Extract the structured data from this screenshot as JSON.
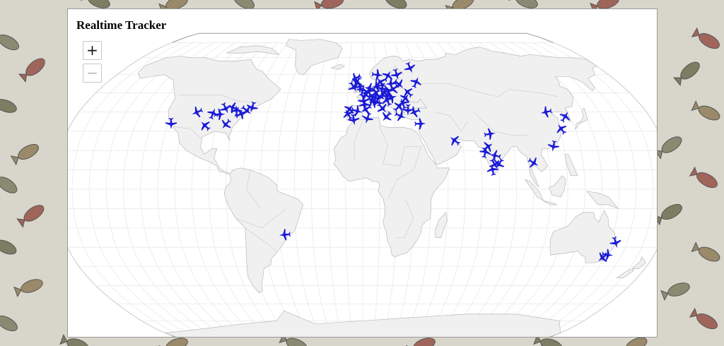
{
  "title": "Realtime Tracker",
  "zoom": {
    "in_label": "+",
    "out_label": "−"
  },
  "colors": {
    "plane": "#1a1ad6",
    "land": "#f0f0f0",
    "ocean": "#ffffff",
    "background": "#d8d5ca"
  },
  "map": {
    "projection": "robinson",
    "graticule_step_deg": 10
  },
  "aircraft": [
    {
      "lon": -118.4,
      "lat": 34.0
    },
    {
      "lon": -104.9,
      "lat": 39.8
    },
    {
      "lon": -97.0,
      "lat": 32.9
    },
    {
      "lon": -94.6,
      "lat": 39.1
    },
    {
      "lon": -90.3,
      "lat": 38.7
    },
    {
      "lon": -87.9,
      "lat": 41.9
    },
    {
      "lon": -84.4,
      "lat": 33.6
    },
    {
      "lon": -83.3,
      "lat": 42.2
    },
    {
      "lon": -80.3,
      "lat": 40.5
    },
    {
      "lon": -77.0,
      "lat": 38.9
    },
    {
      "lon": -74.0,
      "lat": 40.7
    },
    {
      "lon": -71.0,
      "lat": 42.4
    },
    {
      "lon": -46.6,
      "lat": -23.5
    },
    {
      "lon": -9.1,
      "lat": 38.7
    },
    {
      "lon": -8.6,
      "lat": 41.2
    },
    {
      "lon": -3.7,
      "lat": 40.4
    },
    {
      "lon": -5.6,
      "lat": 36.0
    },
    {
      "lon": 2.1,
      "lat": 41.4
    },
    {
      "lon": 2.3,
      "lat": 48.9
    },
    {
      "lon": -0.1,
      "lat": 51.5
    },
    {
      "lon": -2.2,
      "lat": 53.4
    },
    {
      "lon": -6.3,
      "lat": 53.3
    },
    {
      "lon": -4.2,
      "lat": 55.9
    },
    {
      "lon": 4.9,
      "lat": 52.4
    },
    {
      "lon": 4.4,
      "lat": 50.8
    },
    {
      "lon": 8.7,
      "lat": 50.1
    },
    {
      "lon": 11.6,
      "lat": 48.1
    },
    {
      "lon": 13.4,
      "lat": 52.5
    },
    {
      "lon": 10.0,
      "lat": 53.6
    },
    {
      "lon": 12.6,
      "lat": 55.7
    },
    {
      "lon": 18.1,
      "lat": 59.3
    },
    {
      "lon": 10.7,
      "lat": 59.9
    },
    {
      "lon": 24.9,
      "lat": 60.2
    },
    {
      "lon": 21.0,
      "lat": 52.2
    },
    {
      "lon": 14.4,
      "lat": 50.1
    },
    {
      "lon": 16.4,
      "lat": 48.2
    },
    {
      "lon": 19.0,
      "lat": 47.5
    },
    {
      "lon": 12.5,
      "lat": 41.9
    },
    {
      "lon": 9.2,
      "lat": 45.5
    },
    {
      "lon": 7.7,
      "lat": 45.1
    },
    {
      "lon": 26.1,
      "lat": 44.4
    },
    {
      "lon": 23.3,
      "lat": 42.7
    },
    {
      "lon": 23.7,
      "lat": 37.9
    },
    {
      "lon": 28.9,
      "lat": 41.0
    },
    {
      "lon": 32.9,
      "lat": 39.9
    },
    {
      "lon": 30.5,
      "lat": 50.4
    },
    {
      "lon": 37.6,
      "lat": 55.8
    },
    {
      "lon": 35.5,
      "lat": 33.9
    },
    {
      "lon": 36.0,
      "lat": 64.0
    },
    {
      "lon": 15.0,
      "lat": 37.5
    },
    {
      "lon": 6.1,
      "lat": 46.2
    },
    {
      "lon": 1.4,
      "lat": 43.6
    },
    {
      "lon": 17.0,
      "lat": 51.1
    },
    {
      "lon": 25.3,
      "lat": 54.7
    },
    {
      "lon": 3.0,
      "lat": 36.7
    },
    {
      "lon": 20.0,
      "lat": 55.0
    },
    {
      "lon": 16.0,
      "lat": 46.0
    },
    {
      "lon": 28.0,
      "lat": 47.0
    },
    {
      "lon": 8.0,
      "lat": 47.5
    },
    {
      "lon": 0.5,
      "lat": 46.0
    },
    {
      "lon": -5.0,
      "lat": 58.0
    },
    {
      "lon": 55.3,
      "lat": 25.2
    },
    {
      "lon": 72.9,
      "lat": 19.1
    },
    {
      "lon": 77.1,
      "lat": 28.6
    },
    {
      "lon": 77.7,
      "lat": 13.0
    },
    {
      "lon": 80.3,
      "lat": 13.1
    },
    {
      "lon": 78.5,
      "lat": 17.4
    },
    {
      "lon": 76.3,
      "lat": 10.0
    },
    {
      "lon": 74.8,
      "lat": 22.0
    },
    {
      "lon": 100.7,
      "lat": 13.7
    },
    {
      "lon": 114.1,
      "lat": 22.3
    },
    {
      "lon": 116.4,
      "lat": 39.9
    },
    {
      "lon": 121.5,
      "lat": 31.2
    },
    {
      "lon": 126.9,
      "lat": 37.5
    },
    {
      "lon": 151.2,
      "lat": -33.9
    },
    {
      "lon": 153.0,
      "lat": -27.5
    },
    {
      "lon": 149.1,
      "lat": -35.3
    }
  ]
}
